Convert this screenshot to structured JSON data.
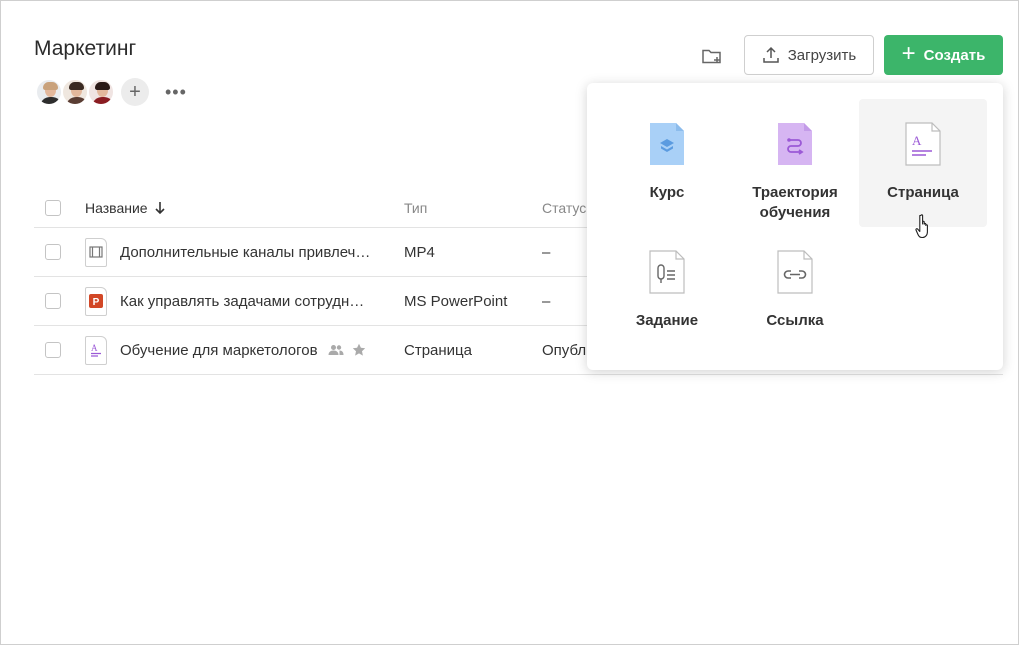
{
  "page": {
    "title": "Маркетинг"
  },
  "members": {
    "avatars": [
      {
        "name": "avatar-1",
        "hair": "#c9a27c",
        "shirt": "#2d2d2d",
        "bg": "#e9ecef"
      },
      {
        "name": "avatar-2",
        "hair": "#3a2a22",
        "shirt": "#5a3d33",
        "bg": "#efe7df"
      },
      {
        "name": "avatar-3",
        "hair": "#2a1a17",
        "shirt": "#8a1d22",
        "bg": "#f0e4e2"
      }
    ],
    "add_label": "+",
    "more_label": "•••"
  },
  "toolbar": {
    "upload_label": "Загрузить",
    "create_label": "Создать"
  },
  "table": {
    "columns": {
      "name": "Название",
      "type": "Тип",
      "status": "Статус"
    },
    "rows": [
      {
        "name": "Дополнительные каналы привлеч…",
        "type": "MP4",
        "status": "–",
        "icon": "video-file-icon"
      },
      {
        "name": "Как управлять задачами сотрудн…",
        "type": "MS PowerPoint",
        "status": "–",
        "icon": "powerpoint-file-icon"
      },
      {
        "name": "Обучение для маркетологов",
        "type": "Страница",
        "status": "Опубл",
        "icon": "page-file-icon"
      }
    ]
  },
  "create_menu": {
    "items": [
      {
        "label": "Курс",
        "icon": "course-icon",
        "color": "#a9d0f7"
      },
      {
        "label": "Траектория обучения",
        "icon": "learning-path-icon",
        "color": "#d6b5f2"
      },
      {
        "label": "Страница",
        "icon": "page-icon",
        "color": "#9b59d6"
      },
      {
        "label": "Задание",
        "icon": "assignment-icon",
        "color": "#666666"
      },
      {
        "label": "Ссылка",
        "icon": "link-icon",
        "color": "#666666"
      }
    ]
  },
  "colors": {
    "accent": "#3cb56a",
    "border": "#e3e3e3"
  }
}
